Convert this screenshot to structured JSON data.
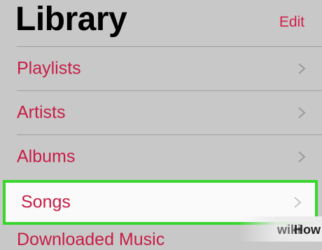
{
  "header": {
    "title": "Library",
    "edit_label": "Edit"
  },
  "items": [
    {
      "label": "Playlists"
    },
    {
      "label": "Artists"
    },
    {
      "label": "Albums"
    },
    {
      "label": "Songs"
    },
    {
      "label": "Downloaded Music"
    }
  ],
  "colors": {
    "accent": "#c71d45",
    "highlight_border": "#3ad630",
    "background": "#c8c8c8"
  },
  "icons": {
    "row_chevron": "chevron-right-icon"
  },
  "watermark": {
    "wiki": "wiki",
    "how": "How"
  }
}
